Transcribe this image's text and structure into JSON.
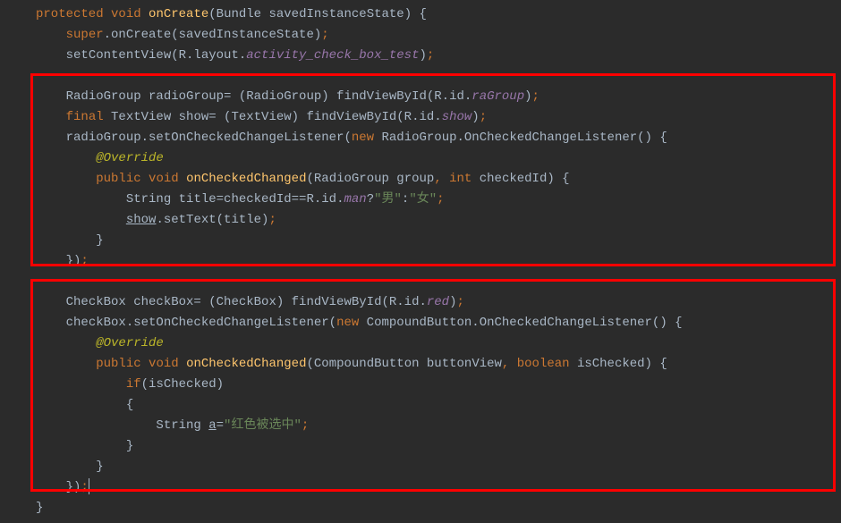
{
  "code": {
    "line1_kw1": "protected",
    "line1_kw2": "void",
    "line1_method": "onCreate",
    "line1_params": "(Bundle savedInstanceState) {",
    "line2_kw": "super",
    "line2_call": ".onCreate(savedInstanceState)",
    "line2_semi": ";",
    "line3_call": "setContentView(R.layout.",
    "line3_field": "activity_check_box_test",
    "line3_end": ")",
    "line3_semi": ";",
    "line5_type": "RadioGroup radioGroup= (RadioGroup) findViewById(R.id.",
    "line5_field": "raGroup",
    "line5_end": ")",
    "line5_semi": ";",
    "line6_kw": "final",
    "line6_rest": " TextView show= (TextView) findViewById(R.id.",
    "line6_field": "show",
    "line6_end": ")",
    "line6_semi": ";",
    "line7_pre": "radioGroup.setOnCheckedChangeListener(",
    "line7_kw": "new",
    "line7_post": " RadioGroup.OnCheckedChangeListener() {",
    "line8_anno": "@Override",
    "line9_kw1": "public",
    "line9_kw2": "void",
    "line9_method": "onCheckedChanged",
    "line9_params1": "(RadioGroup group",
    "line9_comma": ", ",
    "line9_kw3": "int",
    "line9_params2": " checkedId) {",
    "line10_pre": "String title=checkedId==R.id.",
    "line10_field": "man",
    "line10_q": "?",
    "line10_str1": "\"男\"",
    "line10_colon": ":",
    "line10_str2": "\"女\"",
    "line10_semi": ";",
    "line11_show": "show",
    "line11_call": ".setText(title)",
    "line11_semi": ";",
    "line12_brace": "}",
    "line13_brace": "})",
    "line13_semi": ";",
    "line15_type": "CheckBox checkBox= (CheckBox) findViewById(R.id.",
    "line15_field": "red",
    "line15_end": ")",
    "line15_semi": ";",
    "line16_pre": "checkBox.setOnCheckedChangeListener(",
    "line16_kw": "new",
    "line16_post": " CompoundButton.OnCheckedChangeListener() {",
    "line17_anno": "@Override",
    "line18_kw1": "public",
    "line18_kw2": "void",
    "line18_method": "onCheckedChanged",
    "line18_params1": "(CompoundButton buttonView",
    "line18_comma": ", ",
    "line18_kw3": "boolean",
    "line18_params2": " isChecked) {",
    "line19_kw": "if",
    "line19_cond": "(isChecked)",
    "line20_brace": "{",
    "line21_pre": "String ",
    "line21_var": "a",
    "line21_eq": "=",
    "line21_str": "\"红色被选中\"",
    "line21_semi": ";",
    "line22_brace": "}",
    "line23_brace": "}",
    "line24_brace": "})",
    "line24_semi": ";",
    "line25_brace": "}"
  }
}
